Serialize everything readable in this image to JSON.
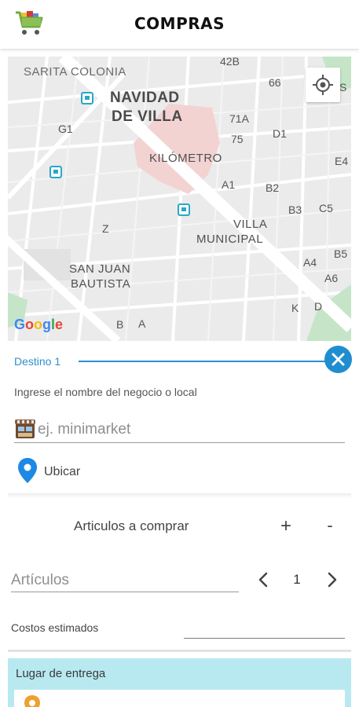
{
  "header": {
    "title": "COMPRAS",
    "cart_icon": "shopping-cart-icon"
  },
  "map": {
    "provider_logo": "Google",
    "labels": {
      "sarita_colonia": "SARITA COLONIA",
      "navidad_de_villa_1": "NAVIDAD",
      "navidad_de_villa_2": "DE VILLA",
      "kilometro": "KILÓMETRO",
      "villa_municipal_1": "VILLA",
      "villa_municipal_2": "MUNICIPAL",
      "san_juan_1": "SAN JUAN",
      "san_juan_2": "BAUTISTA",
      "g1": "G1",
      "z": "Z",
      "b": "B",
      "a": "A",
      "k": "K",
      "d": "D",
      "42b": "42B",
      "66": "66",
      "s": "S",
      "71a": "71A",
      "75": "75",
      "d1": "D1",
      "e4": "E4",
      "a1": "A1",
      "b2": "B2",
      "b3": "B3",
      "c5": "C5",
      "a4": "A4",
      "b5": "B5",
      "a6": "A6"
    }
  },
  "destination": {
    "label": "Destino 1",
    "hint": "Ingrese el nombre del negocio o local",
    "store_placeholder": "ej. minimarket",
    "locate_label": "Ubicar"
  },
  "articles": {
    "header_label": "Articulos a comprar",
    "add_label": "+",
    "remove_label": "-",
    "input_placeholder": "Artículos",
    "quantity": "1"
  },
  "costs": {
    "label": "Costos estimados"
  },
  "delivery": {
    "label": "Lugar de entrega",
    "accent_color": "#b8e9f1"
  },
  "colors": {
    "primary": "#1f8ed0",
    "pin": "#1e88e5",
    "map_highlight": "#f3d2d2",
    "map_park": "#c6e5c8"
  }
}
